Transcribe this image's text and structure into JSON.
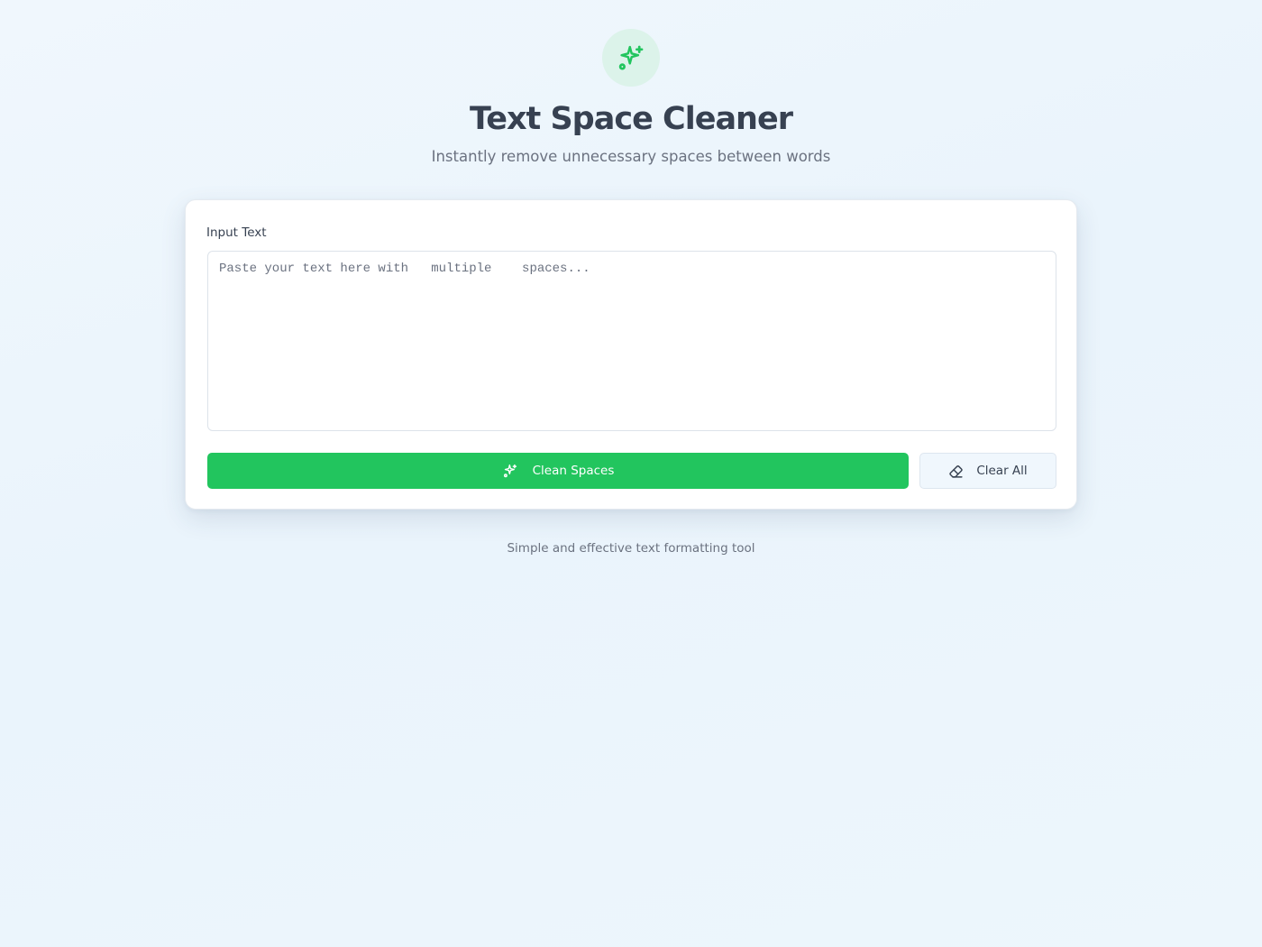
{
  "app": {
    "title": "Text Space Cleaner",
    "subtitle": "Instantly remove unnecessary spaces between words",
    "logo_icon": "sparkles-icon",
    "accent_color": "#22c55e"
  },
  "card": {
    "input_label": "Input Text",
    "input_value": "",
    "input_placeholder": "Paste your text here with   multiple    spaces...",
    "clean_button": {
      "label": "Clean Spaces",
      "icon": "sparkles-icon"
    },
    "clear_button": {
      "label": "Clear All",
      "icon": "eraser-icon"
    }
  },
  "footer": {
    "text": "Simple and effective text formatting tool"
  }
}
